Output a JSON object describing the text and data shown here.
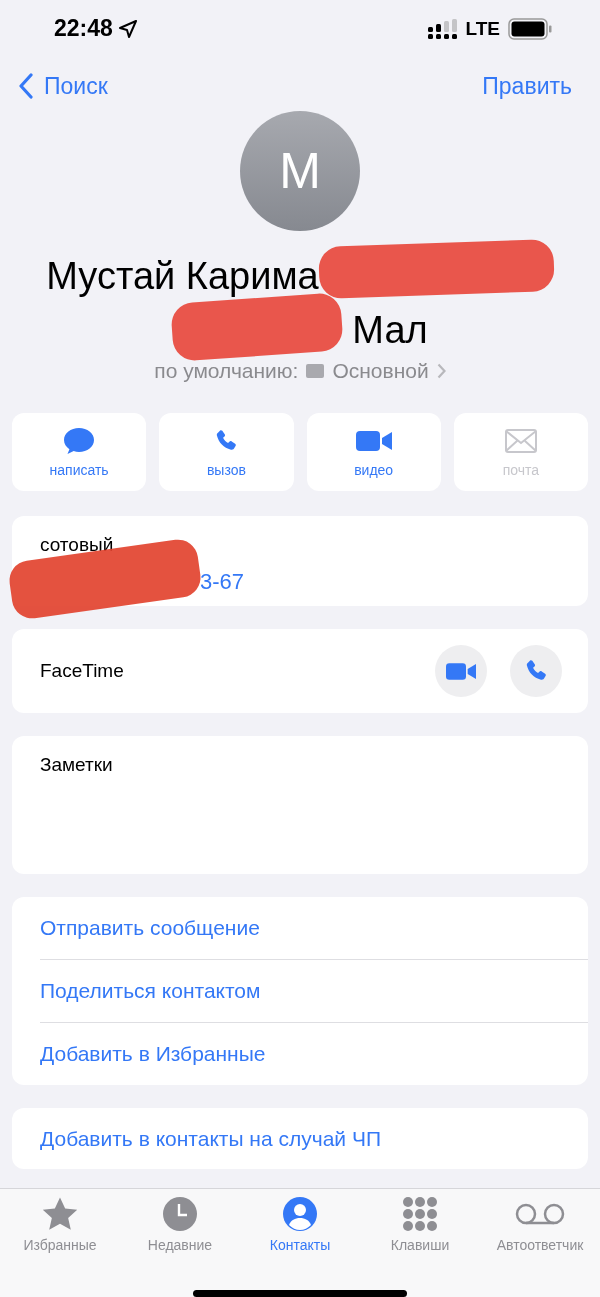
{
  "status_bar": {
    "time": "22:48",
    "network": "LTE"
  },
  "nav": {
    "back": "Поиск",
    "edit": "Править"
  },
  "contact": {
    "initial": "М",
    "name_line_1": "Мустай Карима",
    "name_line_2": "Мал",
    "default_label": "по умолчанию:",
    "default_account": "Основной"
  },
  "actions": [
    {
      "label": "написать",
      "disabled": false
    },
    {
      "label": "вызов",
      "disabled": false
    },
    {
      "label": "видео",
      "disabled": false
    },
    {
      "label": "почта",
      "disabled": true
    }
  ],
  "phone": {
    "label": "сотовый",
    "number": "3-67"
  },
  "facetime": {
    "label": "FaceTime"
  },
  "notes": {
    "label": "Заметки"
  },
  "links": [
    "Отправить сообщение",
    "Поделиться контактом",
    "Добавить в Избранные"
  ],
  "emergency": "Добавить в контакты на случай ЧП",
  "tabs": [
    {
      "label": "Избранные",
      "selected": false
    },
    {
      "label": "Недавние",
      "selected": false
    },
    {
      "label": "Контакты",
      "selected": true
    },
    {
      "label": "Клавиши",
      "selected": false
    },
    {
      "label": "Автоответчик",
      "selected": false
    }
  ]
}
